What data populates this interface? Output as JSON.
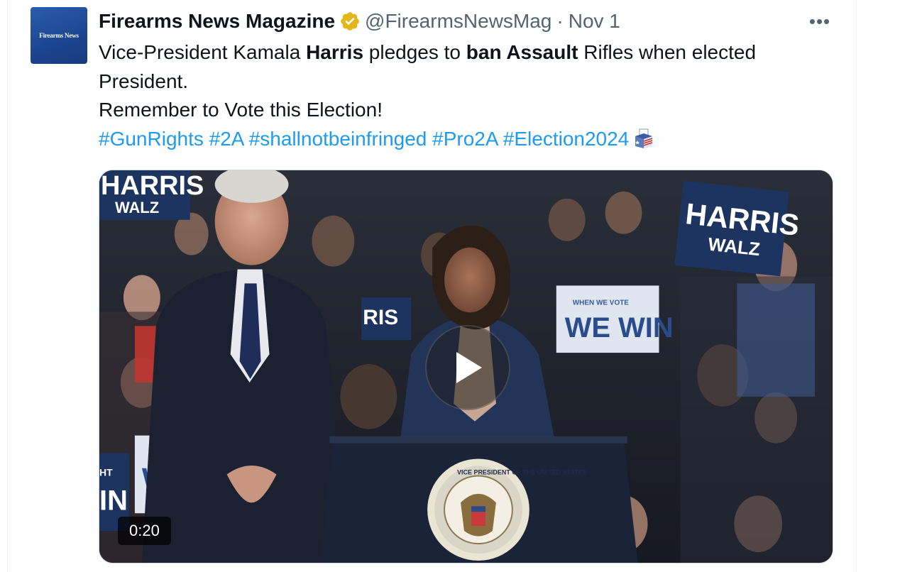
{
  "colors": {
    "text": "#0f1419",
    "secondary": "#536471",
    "link": "#1d9bf0",
    "verified_badge": "#e2b719",
    "avatar_bg": "#1c4590"
  },
  "author": {
    "avatar_text": "Firearms News",
    "display_name": "Firearms News Magazine",
    "verified_icon": "gold-verified-badge",
    "handle": "@FirearmsNewsMag",
    "separator": "·",
    "date": "Nov 1"
  },
  "more_menu": {
    "icon": "more-horizontal-icon",
    "label": "•••"
  },
  "tweet": {
    "line1": {
      "part1": "Vice-President Kamala ",
      "bold1": "Harris",
      "part2": " pledges to ",
      "bold2": "ban Assault",
      "part3": " Rifles when elected"
    },
    "line2": "President.",
    "line3": "Remember to Vote this Election!",
    "hashtags": [
      "#GunRights",
      "#2A",
      "#shallnotbeinfringed",
      "#Pro2A",
      "#Election2024"
    ],
    "trailing_emoji": "ballot-box-icon"
  },
  "media": {
    "type": "video",
    "duration": "0:20",
    "play_icon": "play-icon",
    "signs": {
      "sign_top_left_line1": "HARRIS",
      "sign_top_left_line2": "WALZ",
      "sign_right_line1": "HARRIS",
      "sign_right_line2": "WALZ",
      "sign_center_line1": "WHEN WE VOTE",
      "sign_center_line2": "WE WIN",
      "sign_mid_partial": "RIS",
      "sign_bottom_left_a": "WE",
      "sign_bottom_left_b": "IN",
      "sign_bottom_left_c": "HT"
    },
    "seal_text": "VICE PRESIDENT OF THE UNITED STATES"
  }
}
